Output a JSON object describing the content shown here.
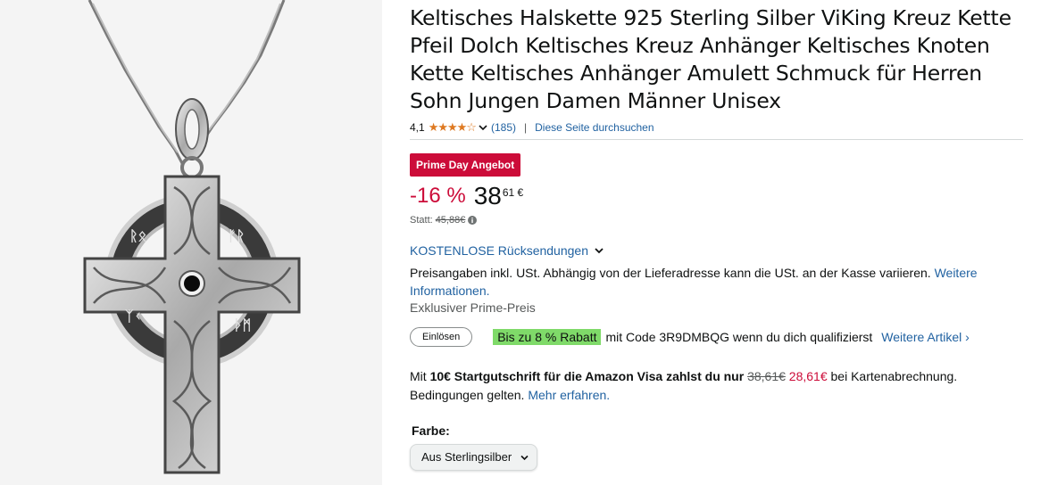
{
  "product": {
    "image_alt_icon": "celtic-cross-pendant",
    "title": "Keltisches Halskette 925 Sterling Silber ViKing Kreuz Kette Pfeil Dolch Keltisches Kreuz Anhänger Keltisches Knoten Kette Keltisches Anhänger Amulett Schmuck für Herren Sohn Jungen Damen Männer Unisex"
  },
  "rating": {
    "value": "4,1",
    "stars_fraction": 0.82,
    "stars_glyph": "★★★★☆",
    "count": "(185)",
    "search_link": "Diese Seite durchsuchen"
  },
  "deal": {
    "badge": "Prime Day Angebot",
    "discount": "-16 %",
    "price_whole": "38",
    "price_fraction": "61 €",
    "list_price_label": "Statt:",
    "list_price": "45,88€"
  },
  "returns": {
    "label": "KOSTENLOSE Rücksendungen"
  },
  "tax": {
    "text": "Preisangaben inkl. USt. Abhängig von der Lieferadresse kann die USt. an der Kasse variieren.",
    "link": "Weitere Informationen."
  },
  "prime_exclusive": "Exklusiver Prime-Preis",
  "coupon": {
    "redeem": "Einlösen",
    "badge": "Bis zu 8 % Rabatt",
    "text": "mit Code 3R9DMBQG wenn du dich qualifizierst",
    "more": "Weitere Artikel ›"
  },
  "card_offer": {
    "prefix": "Mit",
    "bold": "10€ Startgutschrift für die Amazon Visa zahlst du nur",
    "old_price": "38,61€",
    "new_price": "28,61€",
    "suffix": "bei Kartenabrechnung. Bedingungen gelten.",
    "link": "Mehr erfahren."
  },
  "color": {
    "label": "Farbe:",
    "selected": "Aus Sterlingsilber"
  },
  "colors": {
    "deal_red": "#cc0c39",
    "link_blue": "#2162a1",
    "star_orange": "#de7921",
    "coupon_green": "#7fda69"
  }
}
